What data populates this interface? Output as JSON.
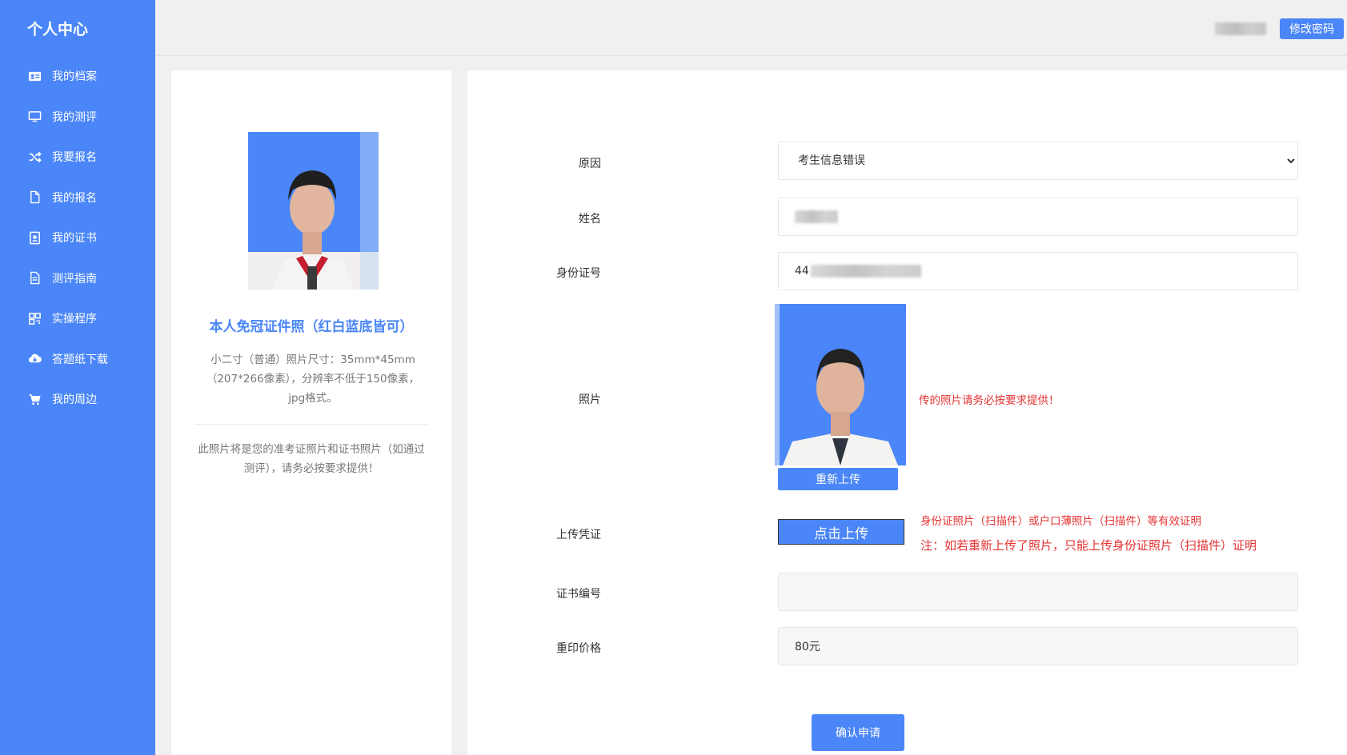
{
  "sidebar": {
    "title": "个人中心",
    "items": [
      {
        "label": "我的档案",
        "icon": "id-card-icon"
      },
      {
        "label": "我的测评",
        "icon": "monitor-icon"
      },
      {
        "label": "我要报名",
        "icon": "shuffle-icon"
      },
      {
        "label": "我的报名",
        "icon": "file-icon"
      },
      {
        "label": "我的证书",
        "icon": "certificate-icon"
      },
      {
        "label": "测评指南",
        "icon": "document-icon"
      },
      {
        "label": "实操程序",
        "icon": "qrcode-icon"
      },
      {
        "label": "答题纸下载",
        "icon": "cloud-download-icon"
      },
      {
        "label": "我的周边",
        "icon": "cart-icon"
      }
    ]
  },
  "header": {
    "change_password_label": "修改密码"
  },
  "photo_card": {
    "title": "本人免冠证件照（红白蓝底皆可）",
    "description": "小二寸（普通）照片尺寸：35mm*45mm（207*266像素），分辨率不低于150像素，jpg格式。",
    "note": "此照片将是您的准考证照片和证书照片（如通过测评），请务必按要求提供！"
  },
  "form": {
    "reason": {
      "label": "原因",
      "value": "考生信息错误"
    },
    "name": {
      "label": "姓名"
    },
    "id_number": {
      "label": "身份证号",
      "visible_prefix": "44"
    },
    "photo": {
      "label": "照片",
      "reupload_label": "重新上传",
      "hint": "传的照片请务必按要求提供！"
    },
    "voucher": {
      "label": "上传凭证",
      "button_label": "点击上传",
      "hint1": "身份证照片（扫描件）或户口薄照片（扫描件）等有效证明",
      "hint2": "注：如若重新上传了照片，只能上传身份证照片（扫描件）证明"
    },
    "cert_number": {
      "label": "证书编号",
      "value": ""
    },
    "reprint_price": {
      "label": "重印价格",
      "value": "80元"
    },
    "submit_label": "确认申请"
  },
  "colors": {
    "accent": "#4a86f7",
    "warning": "#e53333",
    "photo_background": "#4a86f7"
  }
}
